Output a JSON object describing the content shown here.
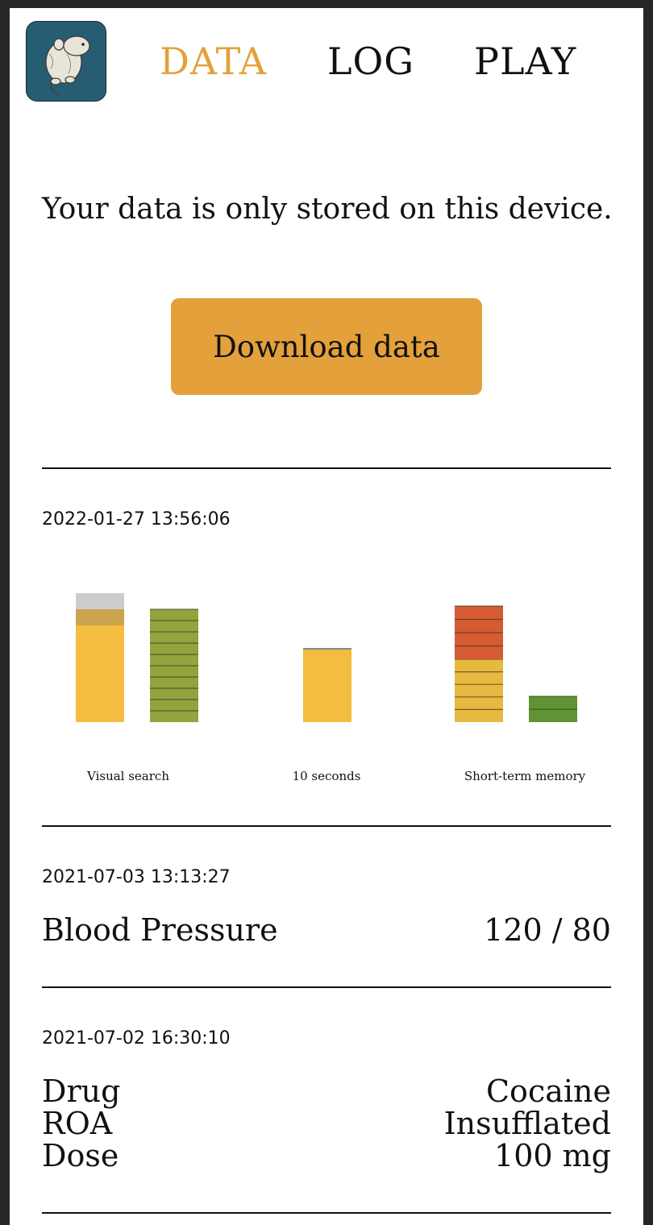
{
  "nav": {
    "items": [
      {
        "label": "DATA",
        "active": true
      },
      {
        "label": "LOG",
        "active": false
      },
      {
        "label": "PLAY",
        "active": false
      }
    ],
    "logo_icon": "rat-logo-icon"
  },
  "notice": "Your data is only stored on this device.",
  "download_button": "Download data",
  "colors": {
    "accent": "#e4a03a",
    "logo_bg": "#265d72"
  },
  "entries": [
    {
      "timestamp": "2022-01-27 13:56:06",
      "chart_data": {
        "type": "bar",
        "categories": [
          "Visual search",
          "10 seconds",
          "Short-term memory"
        ],
        "series": [
          {
            "group": "Visual search",
            "segments": [
              {
                "value": 120,
                "color": "#f4bd40"
              },
              {
                "value": 20,
                "color": "#cca44e"
              },
              {
                "value": 20,
                "color": "#cccccc"
              }
            ]
          },
          {
            "group": "Visual search",
            "segments": [
              {
                "value": 140,
                "color": "#93a43c",
                "stripes": 10
              }
            ]
          },
          {
            "group": "10 seconds",
            "segments": [
              {
                "value": 90,
                "color": "#f4bd40"
              },
              {
                "value": 2,
                "color": "#7b8a9a"
              }
            ]
          },
          {
            "group": "Short-term memory",
            "segments": [
              {
                "value": 78,
                "color": "#e6ba40",
                "stripes": 5
              },
              {
                "value": 66,
                "color": "#d65a32",
                "stripes": 4
              }
            ]
          },
          {
            "group": "Short-term memory",
            "segments": [
              {
                "value": 32,
                "color": "#5f9333",
                "stripes": 2
              }
            ]
          }
        ],
        "ylim": [
          0,
          160
        ]
      }
    },
    {
      "timestamp": "2021-07-03 13:13:27",
      "label": "Blood Pressure",
      "value": "120 / 80"
    },
    {
      "timestamp": "2021-07-02 16:30:10",
      "rows": [
        {
          "label": "Drug",
          "value": "Cocaine"
        },
        {
          "label": "ROA",
          "value": "Insufflated"
        },
        {
          "label": "Dose",
          "value": "100 mg"
        }
      ]
    }
  ]
}
